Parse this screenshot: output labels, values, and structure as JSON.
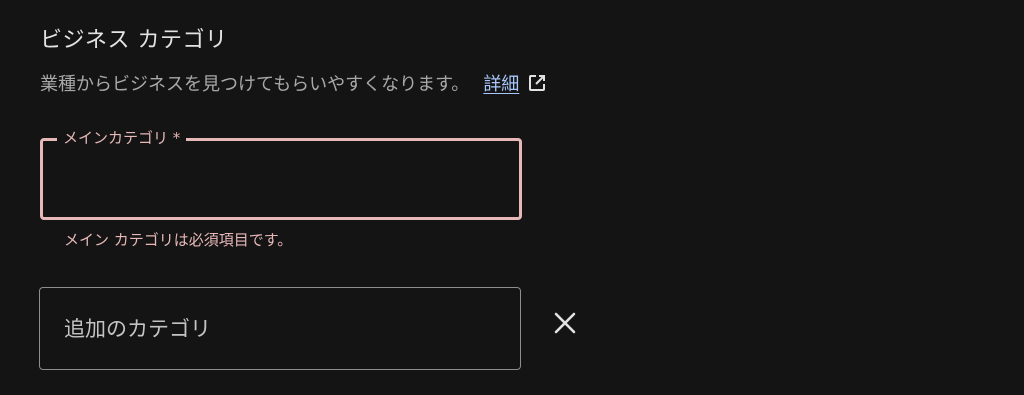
{
  "section": {
    "title": "ビジネス カテゴリ",
    "description": "業種からビジネスを見つけてもらいやすくなります。",
    "learn_more_label": "詳細",
    "learn_more_icon": "open-in-new-icon"
  },
  "main_category": {
    "label": "メインカテゴリ *",
    "value": "",
    "error": "メイン カテゴリは必須項目です。",
    "error_color": "#e7b8b8"
  },
  "additional_category": {
    "placeholder": "追加のカテゴリ",
    "value": "",
    "remove_icon": "close-icon"
  },
  "colors": {
    "background": "#141414",
    "link": "#a8c7fa",
    "text": "#e3e3e3",
    "muted": "#a8a8a8"
  }
}
